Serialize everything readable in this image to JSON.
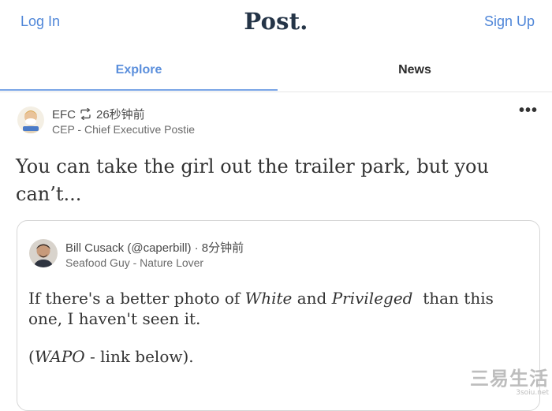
{
  "header": {
    "login_label": "Log In",
    "logo_text": "Post.",
    "signup_label": "Sign Up"
  },
  "tabs": [
    {
      "label": "Explore",
      "active": true
    },
    {
      "label": "News",
      "active": false
    }
  ],
  "post": {
    "author_name": "EFC",
    "time": "26秒钟前",
    "author_subtitle": "CEP - Chief Executive Postie",
    "text": "You can take the girl out the trailer park, but you can’t...",
    "more_icon": "ellipsis-icon",
    "repost_icon": "repost-icon"
  },
  "quote": {
    "author_line": "Bill Cusack (@caperbill)",
    "separator": "·",
    "time": "8分钟前",
    "author_subtitle": "Seafood Guy - Nature Lover",
    "para1_part1": "If there's a better photo of ",
    "para1_em1": "White",
    "para1_part2": " and ",
    "para1_em2": "Privileged",
    "para1_part3": "  than this one, I haven't seen it.",
    "para2_part1": "(",
    "para2_em": "WAPO",
    "para2_part2": " - link below)."
  },
  "watermark": {
    "text_cn": "三易生活",
    "text_url": "3soiu.net"
  },
  "colors": {
    "accent": "#4f86d8",
    "tab_active_underline": "#7aa5e6",
    "logo": "#243447"
  }
}
